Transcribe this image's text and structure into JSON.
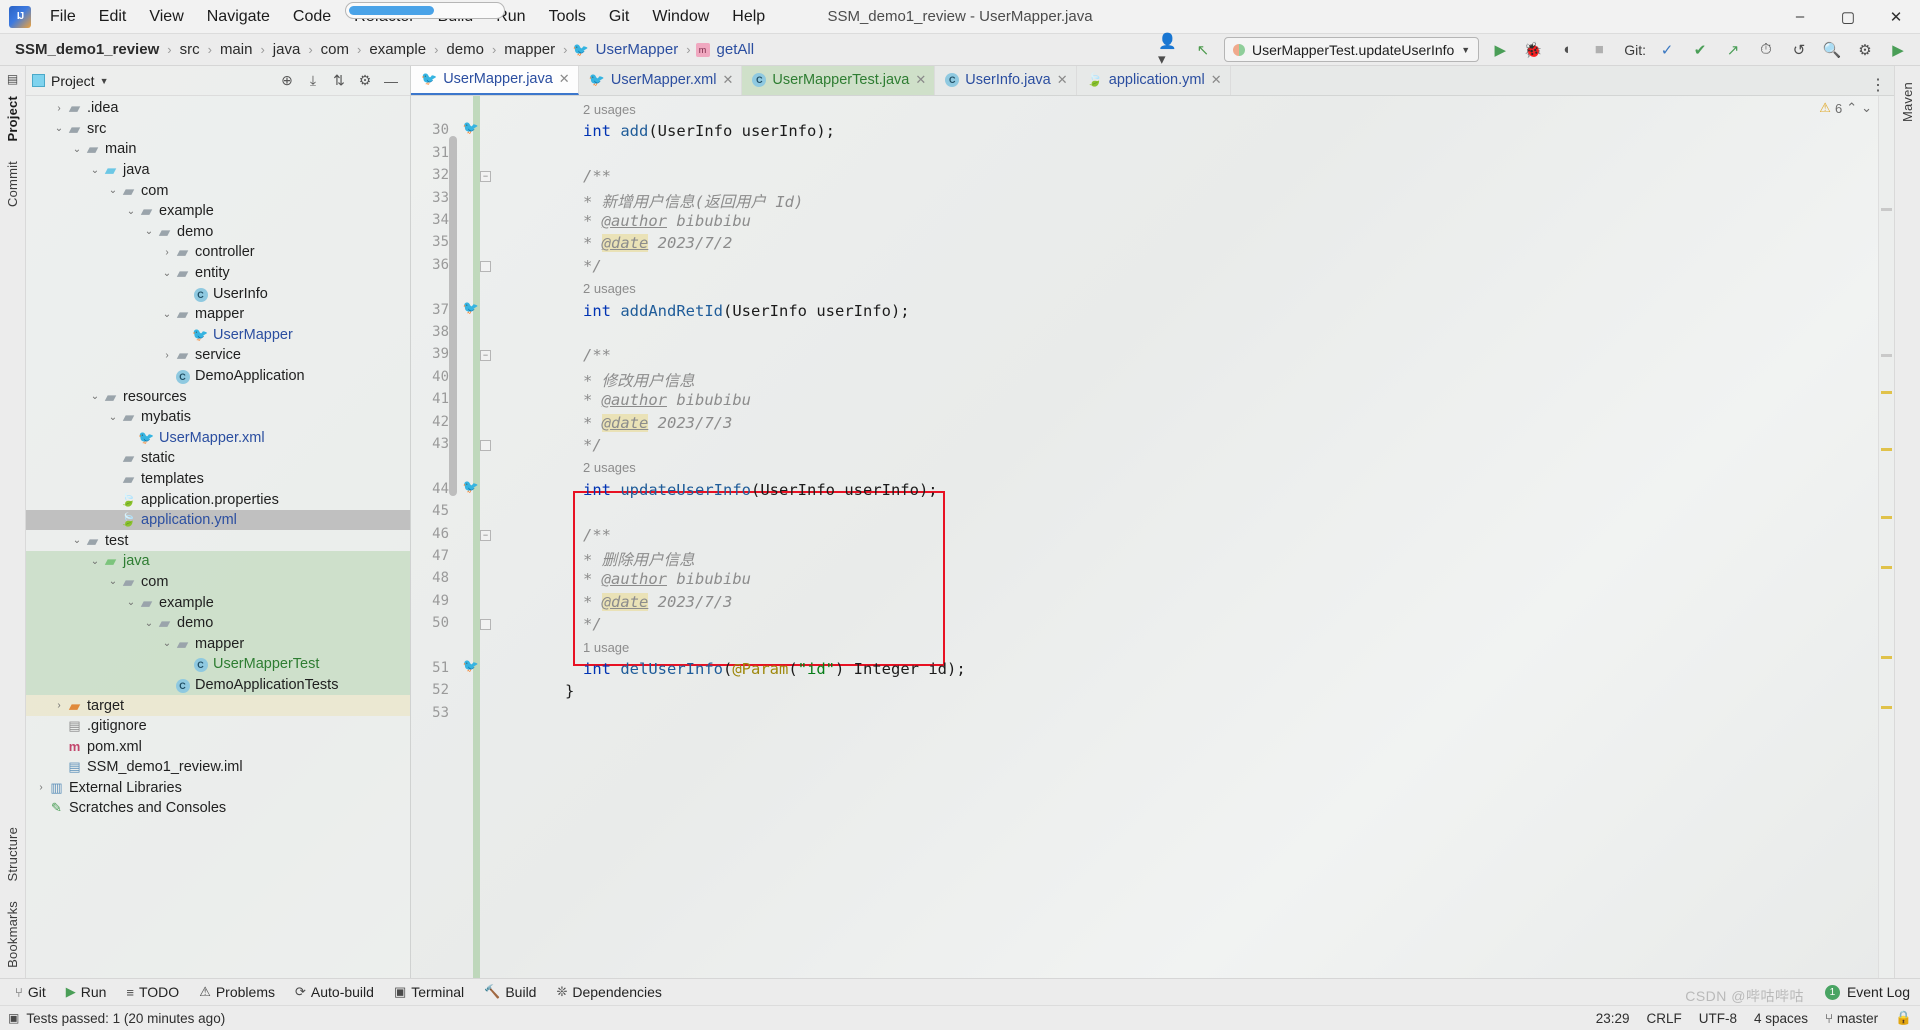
{
  "window": {
    "title": "SSM_demo1_review - UserMapper.java",
    "logo_text": "IJ",
    "minimize": "–",
    "maximize": "▢",
    "close": "✕"
  },
  "menu": [
    {
      "label": "File"
    },
    {
      "label": "Edit"
    },
    {
      "label": "View"
    },
    {
      "label": "Navigate"
    },
    {
      "label": "Code"
    },
    {
      "label": "Refactor"
    },
    {
      "label": "Build"
    },
    {
      "label": "Run"
    },
    {
      "label": "Tools"
    },
    {
      "label": "Git"
    },
    {
      "label": "Window"
    },
    {
      "label": "Help"
    }
  ],
  "breadcrumb": {
    "items": [
      {
        "label": "SSM_demo1_review",
        "style": "bold"
      },
      {
        "label": "src",
        "style": "plain"
      },
      {
        "label": "main",
        "style": "plain"
      },
      {
        "label": "java",
        "style": "plain"
      },
      {
        "label": "com",
        "style": "plain"
      },
      {
        "label": "example",
        "style": "plain"
      },
      {
        "label": "demo",
        "style": "plain"
      },
      {
        "label": "mapper",
        "style": "plain"
      },
      {
        "label": "UserMapper",
        "style": "link",
        "icon": "mybatis-mapper-icon"
      },
      {
        "label": "getAll",
        "style": "link",
        "icon": "method-icon"
      }
    ],
    "separator": "›"
  },
  "toolbar": {
    "user_icon": "user-avatar-icon",
    "update_icon": "vcs-update-icon",
    "run_config": "UserMapperTest.updateUserInfo",
    "run_button": "▶",
    "debug_button": "debug-icon",
    "coverage_button": "coverage-icon",
    "stop_button": "■",
    "git_label": "Git:",
    "git_icons": [
      "checkmark-blue-icon",
      "checkmark-green-icon",
      "push-icon"
    ],
    "history_icon": "⏱",
    "undo_icon": "↺",
    "search_icon": "🔍",
    "settings_icon": "⚙",
    "play_green_icon": "▶"
  },
  "rail_left": [
    {
      "label": "Project",
      "selected": true
    },
    {
      "label": "Commit",
      "selected": false
    },
    {
      "label": "Structure",
      "selected": false
    },
    {
      "label": "Bookmarks",
      "selected": false
    }
  ],
  "rail_right": [
    {
      "label": "Maven"
    }
  ],
  "project_panel": {
    "title": "Project",
    "tools": [
      "locate-icon",
      "collapse-all-icon",
      "expand-icon",
      "settings-icon",
      "hide-icon"
    ],
    "tree": [
      {
        "label": ".idea",
        "depth": 1,
        "arrow": "›",
        "icon": "folder",
        "color": "gray",
        "bg": "none"
      },
      {
        "label": "src",
        "depth": 1,
        "arrow": "⌄",
        "icon": "folder",
        "color": "gray",
        "bg": "none"
      },
      {
        "label": "main",
        "depth": 2,
        "arrow": "⌄",
        "icon": "folder",
        "color": "gray",
        "bg": "none"
      },
      {
        "label": "java",
        "depth": 3,
        "arrow": "⌄",
        "icon": "folder",
        "color": "blue",
        "bg": "none"
      },
      {
        "label": "com",
        "depth": 4,
        "arrow": "⌄",
        "icon": "package",
        "color": "gray",
        "bg": "none"
      },
      {
        "label": "example",
        "depth": 5,
        "arrow": "⌄",
        "icon": "package",
        "color": "gray",
        "bg": "none"
      },
      {
        "label": "demo",
        "depth": 6,
        "arrow": "⌄",
        "icon": "package",
        "color": "gray",
        "bg": "none"
      },
      {
        "label": "controller",
        "depth": 7,
        "arrow": "›",
        "icon": "package",
        "color": "gray",
        "bg": "none"
      },
      {
        "label": "entity",
        "depth": 7,
        "arrow": "⌄",
        "icon": "package",
        "color": "gray",
        "bg": "none"
      },
      {
        "label": "UserInfo",
        "depth": 8,
        "arrow": "",
        "icon": "class",
        "color": "dark",
        "bg": "none"
      },
      {
        "label": "mapper",
        "depth": 7,
        "arrow": "⌄",
        "icon": "package",
        "color": "gray",
        "bg": "none"
      },
      {
        "label": "UserMapper",
        "depth": 8,
        "arrow": "",
        "icon": "mybatis",
        "color": "link",
        "bg": "none"
      },
      {
        "label": "service",
        "depth": 7,
        "arrow": "›",
        "icon": "package",
        "color": "gray",
        "bg": "none"
      },
      {
        "label": "DemoApplication",
        "depth": 7,
        "arrow": "",
        "icon": "springclass",
        "color": "dark",
        "bg": "none"
      },
      {
        "label": "resources",
        "depth": 3,
        "arrow": "⌄",
        "icon": "resources",
        "color": "gray",
        "bg": "none"
      },
      {
        "label": "mybatis",
        "depth": 4,
        "arrow": "⌄",
        "icon": "folder",
        "color": "gray",
        "bg": "none"
      },
      {
        "label": "UserMapper.xml",
        "depth": 5,
        "arrow": "",
        "icon": "mybatisxml",
        "color": "link",
        "bg": "none"
      },
      {
        "label": "static",
        "depth": 4,
        "arrow": "",
        "icon": "folder",
        "color": "gray",
        "bg": "none"
      },
      {
        "label": "templates",
        "depth": 4,
        "arrow": "",
        "icon": "folder",
        "color": "gray",
        "bg": "none"
      },
      {
        "label": "application.properties",
        "depth": 4,
        "arrow": "",
        "icon": "spring",
        "color": "dark",
        "bg": "none"
      },
      {
        "label": "application.yml",
        "depth": 4,
        "arrow": "",
        "icon": "spring",
        "color": "link",
        "bg": "sel"
      },
      {
        "label": "test",
        "depth": 2,
        "arrow": "⌄",
        "icon": "folder",
        "color": "gray",
        "bg": "none"
      },
      {
        "label": "java",
        "depth": 3,
        "arrow": "⌄",
        "icon": "folder",
        "color": "green",
        "bg": "green"
      },
      {
        "label": "com",
        "depth": 4,
        "arrow": "⌄",
        "icon": "package",
        "color": "gray",
        "bg": "green"
      },
      {
        "label": "example",
        "depth": 5,
        "arrow": "⌄",
        "icon": "package",
        "color": "gray",
        "bg": "green"
      },
      {
        "label": "demo",
        "depth": 6,
        "arrow": "⌄",
        "icon": "package",
        "color": "gray",
        "bg": "green"
      },
      {
        "label": "mapper",
        "depth": 7,
        "arrow": "⌄",
        "icon": "package",
        "color": "gray",
        "bg": "green"
      },
      {
        "label": "UserMapperTest",
        "depth": 8,
        "arrow": "",
        "icon": "testclass",
        "color": "green",
        "bg": "green"
      },
      {
        "label": "DemoApplicationTests",
        "depth": 7,
        "arrow": "",
        "icon": "testclass",
        "color": "dark",
        "bg": "green"
      },
      {
        "label": "target",
        "depth": 1,
        "arrow": "›",
        "icon": "folder",
        "color": "orange",
        "bg": "tan"
      },
      {
        "label": ".gitignore",
        "depth": 1,
        "arrow": "",
        "icon": "file",
        "color": "dark",
        "bg": "none"
      },
      {
        "label": "pom.xml",
        "depth": 1,
        "arrow": "",
        "icon": "maven",
        "color": "dark",
        "bg": "none"
      },
      {
        "label": "SSM_demo1_review.iml",
        "depth": 1,
        "arrow": "",
        "icon": "iml",
        "color": "dark",
        "bg": "none"
      },
      {
        "label": "External Libraries",
        "depth": 0,
        "arrow": "›",
        "icon": "libs",
        "color": "dark",
        "bg": "none"
      },
      {
        "label": "Scratches and Consoles",
        "depth": 0,
        "arrow": "",
        "icon": "scratch",
        "color": "dark",
        "bg": "none"
      }
    ]
  },
  "editor_tabs": [
    {
      "label": "UserMapper.java",
      "icon": "mybatis-mapper-icon",
      "state": "active"
    },
    {
      "label": "UserMapper.xml",
      "icon": "mybatis-xml-icon",
      "state": "normal"
    },
    {
      "label": "UserMapperTest.java",
      "icon": "test-class-icon",
      "state": "test"
    },
    {
      "label": "UserInfo.java",
      "icon": "class-icon",
      "state": "normal"
    },
    {
      "label": "application.yml",
      "icon": "spring-leaf-icon",
      "state": "normal"
    }
  ],
  "editor": {
    "warning_count": "6",
    "warning_icon": "⚠",
    "file_path_hint": "UserMapper.java",
    "lines": [
      {
        "num": "",
        "text": "2 usages",
        "type": "usages",
        "bookmark": false,
        "fold": ""
      },
      {
        "num": "30",
        "text": "int add(UserInfo userInfo);",
        "type": "code",
        "bookmark": true,
        "fold": ""
      },
      {
        "num": "31",
        "text": "",
        "type": "blank",
        "bookmark": false,
        "fold": ""
      },
      {
        "num": "32",
        "text": "/**",
        "type": "comment",
        "bookmark": false,
        "fold": "minus"
      },
      {
        "num": "33",
        "text": "* 新增用户信息(返回用户 Id)",
        "type": "comment",
        "bookmark": false,
        "fold": ""
      },
      {
        "num": "34",
        "text": "* @author bibubibu",
        "type": "tagline",
        "bookmark": false,
        "fold": ""
      },
      {
        "num": "35",
        "text": "* @date 2023/7/2",
        "type": "tagline",
        "bookmark": false,
        "fold": ""
      },
      {
        "num": "36",
        "text": "*/",
        "type": "comment",
        "bookmark": false,
        "fold": "end"
      },
      {
        "num": "",
        "text": "2 usages",
        "type": "usages",
        "bookmark": false,
        "fold": ""
      },
      {
        "num": "37",
        "text": "int addAndRetId(UserInfo userInfo);",
        "type": "code",
        "bookmark": true,
        "fold": ""
      },
      {
        "num": "38",
        "text": "",
        "type": "blank",
        "bookmark": false,
        "fold": ""
      },
      {
        "num": "39",
        "text": "/**",
        "type": "comment",
        "bookmark": false,
        "fold": "minus"
      },
      {
        "num": "40",
        "text": "* 修改用户信息",
        "type": "comment",
        "bookmark": false,
        "fold": ""
      },
      {
        "num": "41",
        "text": "* @author bibubibu",
        "type": "tagline",
        "bookmark": false,
        "fold": ""
      },
      {
        "num": "42",
        "text": "* @date 2023/7/3",
        "type": "tagline",
        "bookmark": false,
        "fold": ""
      },
      {
        "num": "43",
        "text": "*/",
        "type": "comment",
        "bookmark": false,
        "fold": "end"
      },
      {
        "num": "",
        "text": "2 usages",
        "type": "usages",
        "bookmark": false,
        "fold": ""
      },
      {
        "num": "44",
        "text": "int updateUserInfo(UserInfo userInfo);",
        "type": "code",
        "bookmark": true,
        "fold": ""
      },
      {
        "num": "45",
        "text": "",
        "type": "blank",
        "bookmark": false,
        "fold": ""
      },
      {
        "num": "46",
        "text": "/**",
        "type": "comment",
        "bookmark": false,
        "fold": "minus"
      },
      {
        "num": "47",
        "text": "* 删除用户信息",
        "type": "comment",
        "bookmark": false,
        "fold": ""
      },
      {
        "num": "48",
        "text": "* @author bibubibu",
        "type": "tagline",
        "bookmark": false,
        "fold": ""
      },
      {
        "num": "49",
        "text": "* @date 2023/7/3",
        "type": "tagline",
        "bookmark": false,
        "fold": ""
      },
      {
        "num": "50",
        "text": "*/",
        "type": "comment",
        "bookmark": false,
        "fold": "end"
      },
      {
        "num": "",
        "text": "1 usage",
        "type": "usages",
        "bookmark": false,
        "fold": ""
      },
      {
        "num": "51",
        "text": "int delUserInfo(@Param(\"id\") Integer id);",
        "type": "code",
        "bookmark": true,
        "fold": ""
      },
      {
        "num": "52",
        "text": "}",
        "type": "brace",
        "bookmark": false,
        "fold": ""
      },
      {
        "num": "53",
        "text": "",
        "type": "blank",
        "bookmark": false,
        "fold": ""
      }
    ]
  },
  "bottom_bar": {
    "items": [
      {
        "label": "Git",
        "icon": "git-branch-icon"
      },
      {
        "label": "Run",
        "icon": "run-icon"
      },
      {
        "label": "TODO",
        "icon": "todo-icon"
      },
      {
        "label": "Problems",
        "icon": "problems-icon"
      },
      {
        "label": "Auto-build",
        "icon": "autobuild-icon"
      },
      {
        "label": "Terminal",
        "icon": "terminal-icon"
      },
      {
        "label": "Build",
        "icon": "build-hammer-icon"
      },
      {
        "label": "Dependencies",
        "icon": "dependencies-icon"
      }
    ],
    "event_log": {
      "label": "Event Log",
      "badge": "1"
    }
  },
  "status_bar": {
    "left_icon": "test-run-icon",
    "message": "Tests passed: 1 (20 minutes ago)",
    "time": "23:29",
    "line_sep": "CRLF",
    "encoding": "UTF-8",
    "indent": "4 spaces",
    "branch": "master",
    "branch_icon": "git-branch-icon",
    "lock_icon": "🔒",
    "watermark": "CSDN @哔咕哔咕"
  },
  "colors": {
    "accent_blue": "#2b4ea0",
    "tab_active_underline": "#3c77cc",
    "highlight_red": "#e81123",
    "test_green": "#2e7d32",
    "keyword": "#0033b3",
    "comment": "#8c8c8c",
    "annotation": "#9e880d",
    "string": "#067d17"
  }
}
